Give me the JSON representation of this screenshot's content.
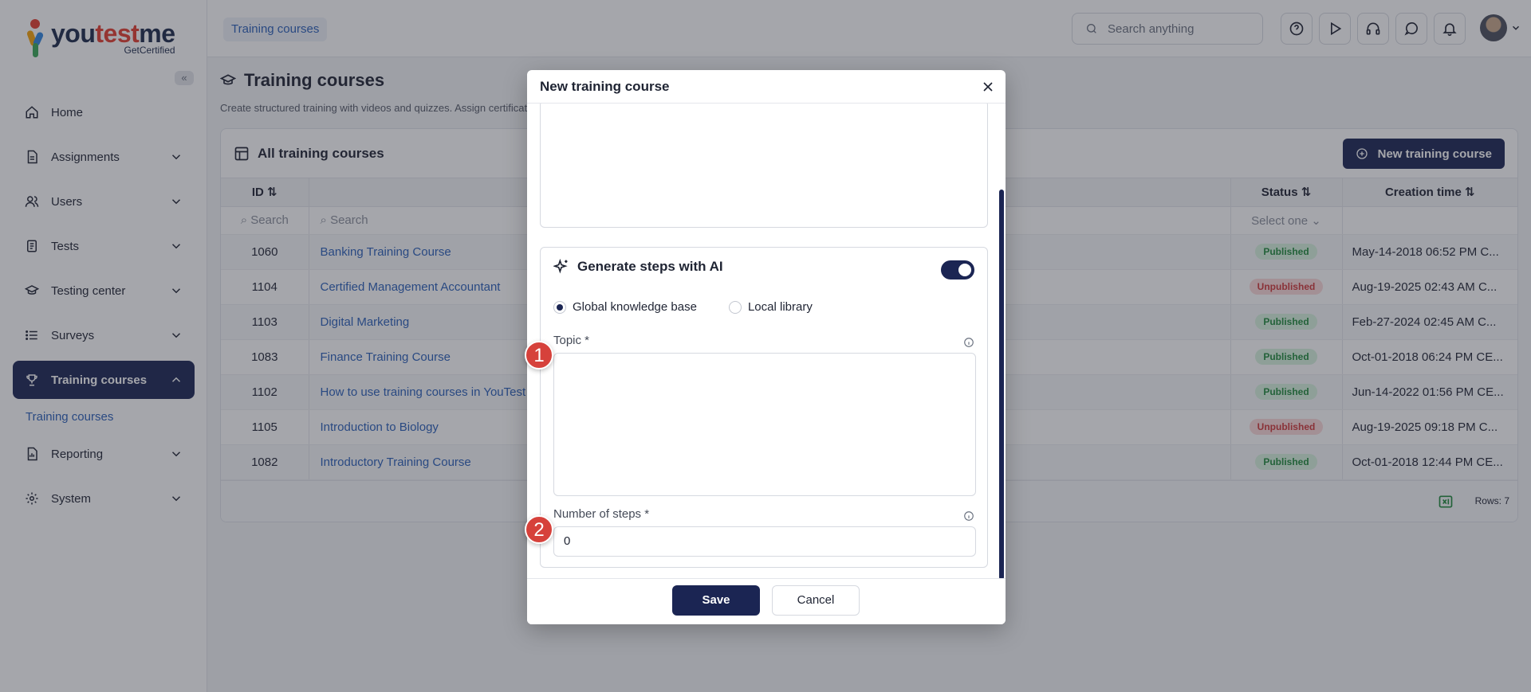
{
  "app": {
    "brand_main": "youtestme",
    "brand_sub": "GetCertified"
  },
  "sidebar": {
    "collapse_label": "«",
    "items": [
      {
        "label": "Home",
        "icon": "home-icon"
      },
      {
        "label": "Assignments",
        "icon": "assignments-icon"
      },
      {
        "label": "Users",
        "icon": "users-icon"
      },
      {
        "label": "Tests",
        "icon": "tests-icon"
      },
      {
        "label": "Testing center",
        "icon": "graduation-cap-icon"
      },
      {
        "label": "Surveys",
        "icon": "list-icon"
      },
      {
        "label": "Training courses",
        "icon": "trophy-icon",
        "active": true
      },
      {
        "label": "Reporting",
        "icon": "report-icon"
      },
      {
        "label": "System",
        "icon": "gear-icon"
      }
    ],
    "sub_item": "Training courses"
  },
  "topbar": {
    "breadcrumb": "Training courses",
    "search_placeholder": "Search anything"
  },
  "page": {
    "title": "Training courses",
    "description": "Create structured training with videos and quizzes. Assign certificat"
  },
  "panel": {
    "title": "All training courses",
    "new_button": "New training course",
    "columns": {
      "id": "ID",
      "status": "Status",
      "time": "Creation time"
    },
    "filters": {
      "id": "Search",
      "name": "Search",
      "status": "Select one"
    },
    "rows": [
      {
        "id": "1060",
        "name": "Banking Training Course",
        "status": "Published",
        "time": "May-14-2018 06:52 PM C..."
      },
      {
        "id": "1104",
        "name": "Certified Management Accountant",
        "status": "Unpublished",
        "time": "Aug-19-2025 02:43 AM C..."
      },
      {
        "id": "1103",
        "name": "Digital Marketing",
        "status": "Published",
        "time": "Feb-27-2024 02:45 AM C..."
      },
      {
        "id": "1083",
        "name": "Finance Training Course",
        "status": "Published",
        "time": "Oct-01-2018 06:24 PM CE..."
      },
      {
        "id": "1102",
        "name": "How to use training courses in YouTest",
        "status": "Published",
        "time": "Jun-14-2022 01:56 PM CE..."
      },
      {
        "id": "1105",
        "name": "Introduction to Biology",
        "status": "Unpublished",
        "time": "Aug-19-2025 09:18 PM C..."
      },
      {
        "id": "1082",
        "name": "Introductory Training Course",
        "status": "Published",
        "time": "Oct-01-2018 12:44 PM CE..."
      }
    ],
    "rows_count": "Rows: 7"
  },
  "modal": {
    "title": "New training course",
    "ai_title": "Generate steps with AI",
    "ai_enabled": true,
    "radio_global": "Global knowledge base",
    "radio_local": "Local library",
    "selected_source": "Global knowledge base",
    "topic_label": "Topic *",
    "topic_value": "",
    "steps_label": "Number of steps *",
    "steps_value": "0",
    "save": "Save",
    "cancel": "Cancel"
  },
  "markers": {
    "one": "1",
    "two": "2"
  },
  "colors": {
    "primary": "#1b2553",
    "link": "#2a5fb8",
    "published": "#1f8a3c",
    "unpublished": "#d0373a",
    "marker": "#d6413b"
  }
}
